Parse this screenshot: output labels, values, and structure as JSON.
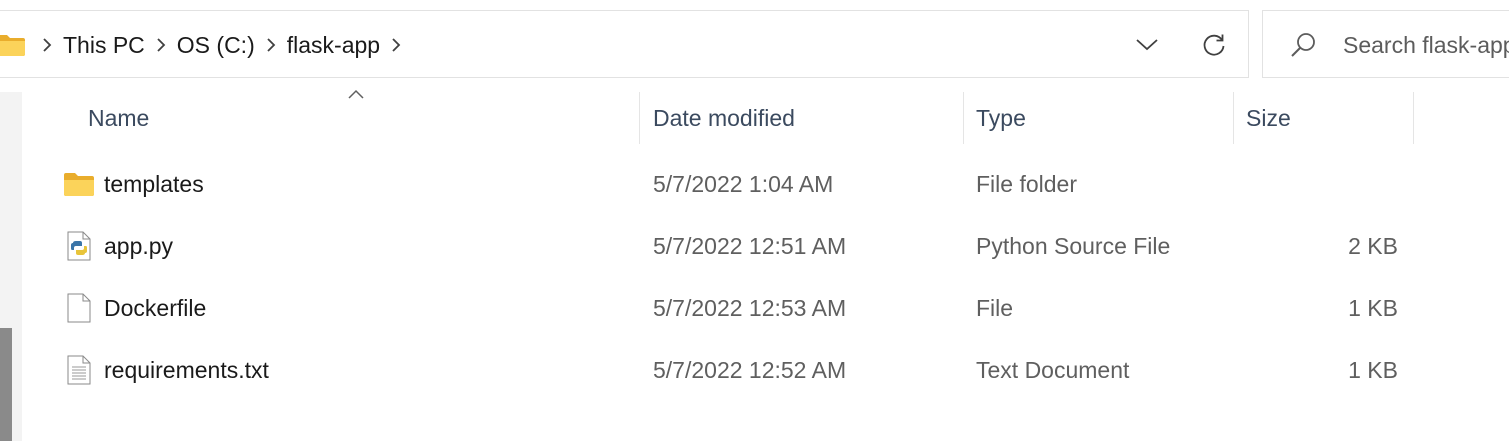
{
  "address_bar": {
    "breadcrumbs": [
      {
        "label": "This PC"
      },
      {
        "label": "OS (C:)"
      },
      {
        "label": "flask-app"
      }
    ]
  },
  "search": {
    "placeholder": "Search flask-app"
  },
  "columns": {
    "name": "Name",
    "date_modified": "Date modified",
    "type": "Type",
    "size": "Size",
    "sorted_by": "name",
    "sort_direction": "ascending"
  },
  "files": [
    {
      "name": "templates",
      "date": "5/7/2022 1:04 AM",
      "type": "File folder",
      "size": "",
      "icon": "folder-icon"
    },
    {
      "name": "app.py",
      "date": "5/7/2022 12:51 AM",
      "type": "Python Source File",
      "size": "2 KB",
      "icon": "python-file-icon"
    },
    {
      "name": "Dockerfile",
      "date": "5/7/2022 12:53 AM",
      "type": "File",
      "size": "1 KB",
      "icon": "blank-file-icon"
    },
    {
      "name": "requirements.txt",
      "date": "5/7/2022 12:52 AM",
      "type": "Text Document",
      "size": "1 KB",
      "icon": "text-file-icon"
    }
  ],
  "colors": {
    "folder": "#f8c542",
    "header_text": "#3b4a5f",
    "secondary_text": "#5f5f5f",
    "border": "#e2e2e2"
  }
}
